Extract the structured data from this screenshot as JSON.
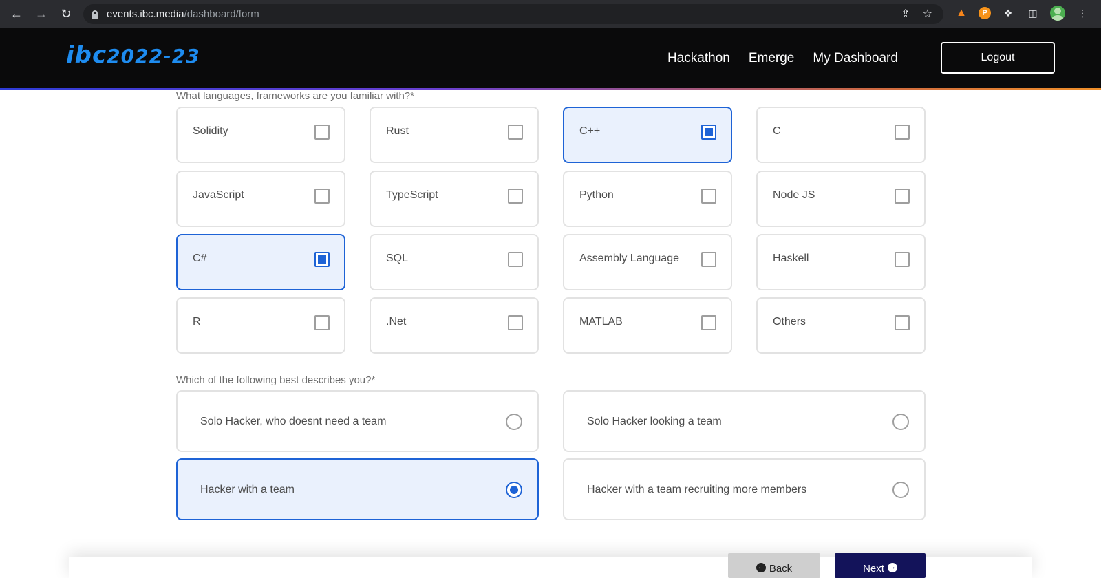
{
  "browser": {
    "url_host": "events.ibc.media",
    "url_path": "/dashboard/form",
    "icons": [
      "back-icon",
      "forward-icon",
      "reload-icon",
      "lock-icon",
      "share-icon",
      "star-icon",
      "metamask-icon",
      "coin-extension-icon",
      "puzzle-icon",
      "side-panel-icon",
      "profile-avatar",
      "menu-dots-icon"
    ]
  },
  "header": {
    "logo_text": "ibc",
    "logo_year": "2022-23",
    "nav": [
      "Hackathon",
      "Emerge",
      "My Dashboard"
    ],
    "logout_label": "Logout"
  },
  "form": {
    "languages_label": "What languages, frameworks are you familiar with?*",
    "languages": [
      {
        "name": "Solidity",
        "checked": false
      },
      {
        "name": "Rust",
        "checked": false
      },
      {
        "name": "C++",
        "checked": true
      },
      {
        "name": "C",
        "checked": false
      },
      {
        "name": "JavaScript",
        "checked": false
      },
      {
        "name": "TypeScript",
        "checked": false
      },
      {
        "name": "Python",
        "checked": false
      },
      {
        "name": "Node JS",
        "checked": false
      },
      {
        "name": "C#",
        "checked": true
      },
      {
        "name": "SQL",
        "checked": false
      },
      {
        "name": "Assembly Language",
        "checked": false
      },
      {
        "name": "Haskell",
        "checked": false
      },
      {
        "name": "R",
        "checked": false
      },
      {
        "name": ".Net",
        "checked": false
      },
      {
        "name": "MATLAB",
        "checked": false
      },
      {
        "name": "Others",
        "checked": false
      }
    ],
    "role_label": "Which of the following best describes you?*",
    "roles": [
      {
        "name": "Solo Hacker, who doesnt need a team",
        "selected": false
      },
      {
        "name": "Solo Hacker looking a team",
        "selected": false
      },
      {
        "name": "Hacker with a team",
        "selected": true
      },
      {
        "name": "Hacker with a team recruiting more members",
        "selected": false
      }
    ],
    "back_label": "Back",
    "next_label": "Next"
  },
  "colors": {
    "accent": "#1e63d6",
    "selected_bg": "#eaf1fd",
    "header_bg": "#0a0a0b",
    "logo": "#1e8cf0",
    "next_button": "#13135a"
  }
}
